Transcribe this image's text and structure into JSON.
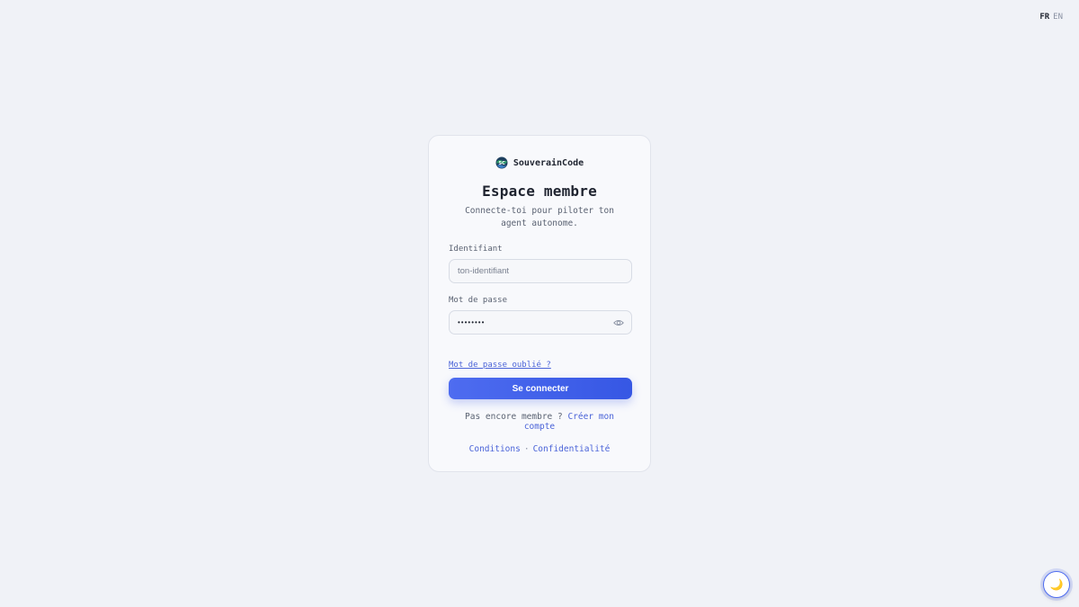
{
  "lang_switch": {
    "fr": "FR",
    "en": "EN",
    "active": "FR"
  },
  "brand": {
    "name": "SouverainCode",
    "logo_icon": "souverain-logo-icon"
  },
  "login": {
    "title": "Espace membre",
    "subtitle": "Connecte-toi pour piloter ton agent autonome.",
    "username_label": "Identifiant",
    "username_placeholder": "ton-identifiant",
    "username_value": "",
    "password_label": "Mot de passe",
    "password_value": "••••••••",
    "password_icon": "eye-icon",
    "forgot_link": "Mot de passe oublié ?",
    "submit_label": "Se connecter",
    "signup_prompt": "Pas encore membre ?",
    "signup_link": "Créer mon compte",
    "terms_link": "Conditions",
    "legal_separator": "·",
    "privacy_link": "Confidentialité"
  },
  "theme_toggle": {
    "icon": "moon-icon",
    "glyph": "🌙"
  },
  "colors": {
    "accent": "#4e6cf0",
    "background": "#f0f2f7",
    "card": "#f8f9fc"
  }
}
